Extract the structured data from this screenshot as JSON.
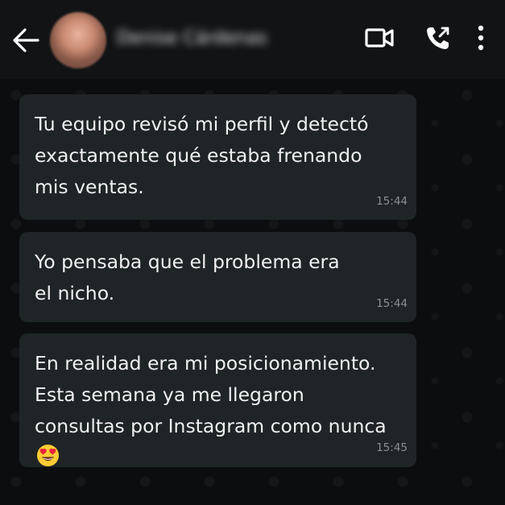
{
  "header": {
    "contact_name": "Denise Cárdenas",
    "icons": [
      "back-arrow-icon",
      "avatar",
      "video-call-icon",
      "phone-call-icon",
      "more-options-icon"
    ]
  },
  "messages": [
    {
      "text": "Tu equipo revisó mi perfil y detectó\nexactamente qué estaba frenando\nmis ventas.",
      "time": "15:44"
    },
    {
      "text": "Yo pensaba que el problema era\nel nicho.",
      "time": "15:44"
    },
    {
      "text": "En realidad era mi posicionamiento.\nEsta semana ya me llegaron\nconsultas por Instagram como nunca",
      "emoji": "heart-eyes-emoji",
      "time": "15:45"
    }
  ],
  "colors": {
    "header_bg": "#111315",
    "chat_bg": "#0b0d0e",
    "bubble_bg": "#1f2426",
    "text": "#f1f1f1",
    "timestamp": "#8a8f92"
  }
}
